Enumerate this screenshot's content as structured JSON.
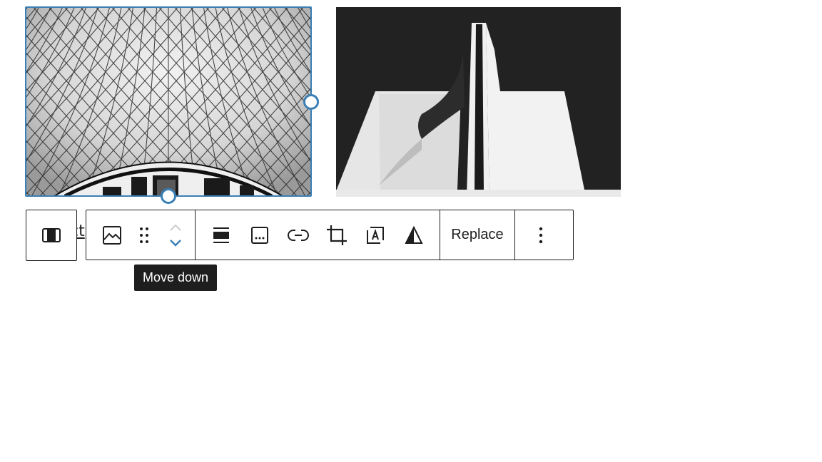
{
  "images": {
    "left": {
      "description_icon": "glass-dome-photo",
      "selected": true
    },
    "right": {
      "description_icon": "white-building-photo",
      "selected": false
    }
  },
  "caption_fragment": "ct",
  "toolbar": {
    "parent_icon": "columns-icon",
    "block_icon": "image-icon",
    "drag_icon": "drag-handle-icon",
    "move_up_icon": "chevron-up-icon",
    "move_down_icon": "chevron-down-icon",
    "align_icon": "align-wide-icon",
    "caption_icon": "caption-icon",
    "link_icon": "link-icon",
    "crop_icon": "crop-icon",
    "text_overlay_icon": "text-overlay-icon",
    "duotone_icon": "duotone-icon",
    "replace_label": "Replace",
    "more_icon": "more-vertical-icon"
  },
  "tooltip": {
    "text": "Move down"
  },
  "colors": {
    "accent": "#3a7fb5",
    "toolbar_border": "#1e1e1e",
    "tooltip_bg": "#1e1e1e"
  }
}
